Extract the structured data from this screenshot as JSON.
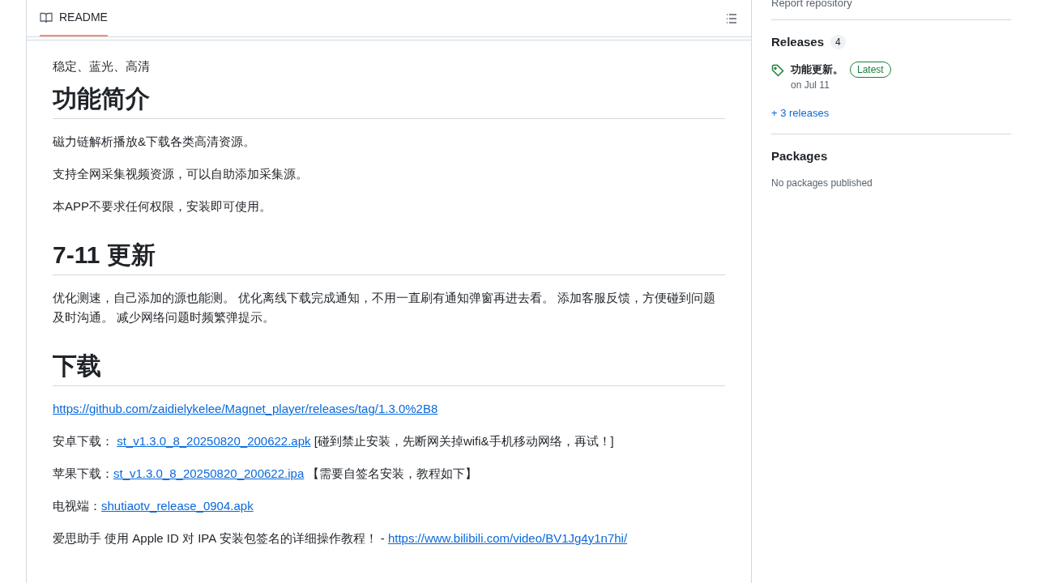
{
  "readme": {
    "tab": {
      "label": "README",
      "selected": true
    },
    "intro": "稳定、蓝光、高清",
    "sections": [
      {
        "heading": "功能简介",
        "paragraphs": [
          [
            {
              "text": "磁力链解析播放&下载各类高清资源。",
              "link": false
            }
          ],
          [
            {
              "text": "支持全网采集视频资源，可以自助添加采集源。",
              "link": false
            }
          ],
          [
            {
              "text": "本APP不要求任何权限，安装即可使用。",
              "link": false
            }
          ]
        ]
      },
      {
        "heading": "7-11 更新",
        "paragraphs": [
          [
            {
              "text": "优化测速，自己添加的源也能测。 优化离线下载完成通知，不用一直刷有通知弹窗再进去看。 添加客服反馈，方便碰到问题及时沟通。 减少网络问题时频繁弹提示。",
              "link": false
            }
          ]
        ]
      },
      {
        "heading": "下载",
        "paragraphs": [
          [
            {
              "text": "https://github.com/zaidielykelee/Magnet_player/releases/tag/1.3.0%2B8",
              "link": true
            }
          ],
          [
            {
              "text": "安卓下载： ",
              "link": false
            },
            {
              "text": "st_v1.3.0_8_20250820_200622.apk",
              "link": true
            },
            {
              "text": " [碰到禁止安装，先断网关掉wifi&手机移动网络，再试！]",
              "link": false
            }
          ],
          [
            {
              "text": "苹果下载：",
              "link": false
            },
            {
              "text": "st_v1.3.0_8_20250820_200622.ipa",
              "link": true
            },
            {
              "text": " 【需要自签名安装，教程如下】",
              "link": false
            }
          ],
          [
            {
              "text": "电视端：",
              "link": false
            },
            {
              "text": "shutiaotv_release_0904.apk",
              "link": true
            }
          ],
          [
            {
              "text": "爱思助手 使用 Apple ID 对 IPA 安装包签名的详细操作教程！ - ",
              "link": false
            },
            {
              "text": "https://www.bilibili.com/video/BV1Jg4y1n7hi/",
              "link": true
            }
          ]
        ]
      }
    ]
  },
  "sidebar": {
    "report_link": "Report repository",
    "releases": {
      "title": "Releases",
      "count": "4",
      "latest": {
        "name": "功能更新。",
        "badge": "Latest",
        "date": "on Jul 11"
      },
      "more": "+ 3 releases"
    },
    "packages": {
      "title": "Packages",
      "empty": "No packages published"
    }
  }
}
